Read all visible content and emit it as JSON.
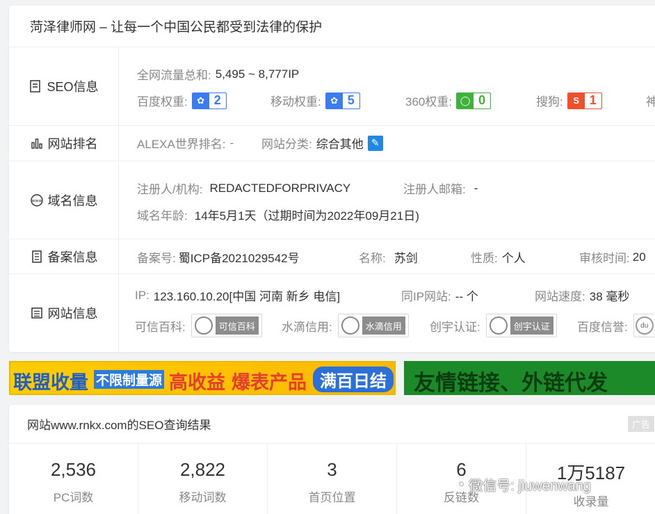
{
  "header": {
    "title": "菏泽律师网 – 让每一个中国公民都受到法律的保护"
  },
  "seo": {
    "label": "SEO信息",
    "traffic_key": "全网流量总和:",
    "traffic_value": "5,495 ~ 8,777IP",
    "baidu_key": "百度权重:",
    "baidu_value": "2",
    "mobile_key": "移动权重:",
    "mobile_value": "5",
    "s360_key": "360权重:",
    "s360_value": "0",
    "sogou_key": "搜狗:",
    "sogou_value": "1",
    "shenma_key": "神"
  },
  "rank": {
    "label": "网站排名",
    "alexa_key": "ALEXA世界排名:",
    "alexa_value": "-",
    "category_key": "网站分类:",
    "category_value": "综合其他"
  },
  "domain": {
    "label": "域名信息",
    "registrant_key": "注册人/机构:",
    "registrant_value": "REDACTEDFORPRIVACY",
    "email_key": "注册人邮箱:",
    "email_value": "-",
    "age_key": "域名年龄:",
    "age_value": "14年5月1天（过期时间为2022年09月21日)"
  },
  "icp": {
    "label": "备案信息",
    "no_key": "备案号:",
    "no_value": "蜀ICP备2021029542号",
    "name_key": "名称:",
    "name_value": "苏剑",
    "nature_key": "性质:",
    "nature_value": "个人",
    "audit_key": "审核时间:",
    "audit_value": "20"
  },
  "site": {
    "label": "网站信息",
    "ip_key": "IP:",
    "ip_value": "123.160.10.20[中国 河南 新乡 电信]",
    "sameip_key": "同IP网站:",
    "sameip_value": "-- 个",
    "speed_key": "网站速度:",
    "speed_value": "38 毫秒",
    "kexin_key": "可信百科:",
    "kexin_badge": "可信百科",
    "shuidi_key": "水滴信用:",
    "shuidi_badge": "水滴信用",
    "chuangyu_key": "创宇认证:",
    "chuangyu_badge": "创宇认证",
    "baidu_trust_key": "百度信誉:",
    "baidu_trust_badge": "du"
  },
  "ads": {
    "left_a": "联盟收量",
    "left_b": "不限制量源",
    "left_c": "高收益",
    "left_d": "爆表产品",
    "left_e": "满百日结",
    "right": "友情链接、外链代发"
  },
  "results": {
    "title": "网站www.rnkx.com的SEO查询结果",
    "ad_tag": "广告",
    "stats": [
      {
        "num": "2,536",
        "label": "PC词数"
      },
      {
        "num": "2,822",
        "label": "移动词数"
      },
      {
        "num": "3",
        "label": "首页位置"
      },
      {
        "num": "6",
        "label": "反链数"
      },
      {
        "num": "1万5187",
        "label": "收录量"
      }
    ]
  },
  "watermark": {
    "text": "微信号: jiuwenwang"
  },
  "colors": {
    "baidu": "#3b7cf5",
    "s360": "#3fb23a",
    "sogou": "#f2502b",
    "edit": "#1e88e5"
  }
}
